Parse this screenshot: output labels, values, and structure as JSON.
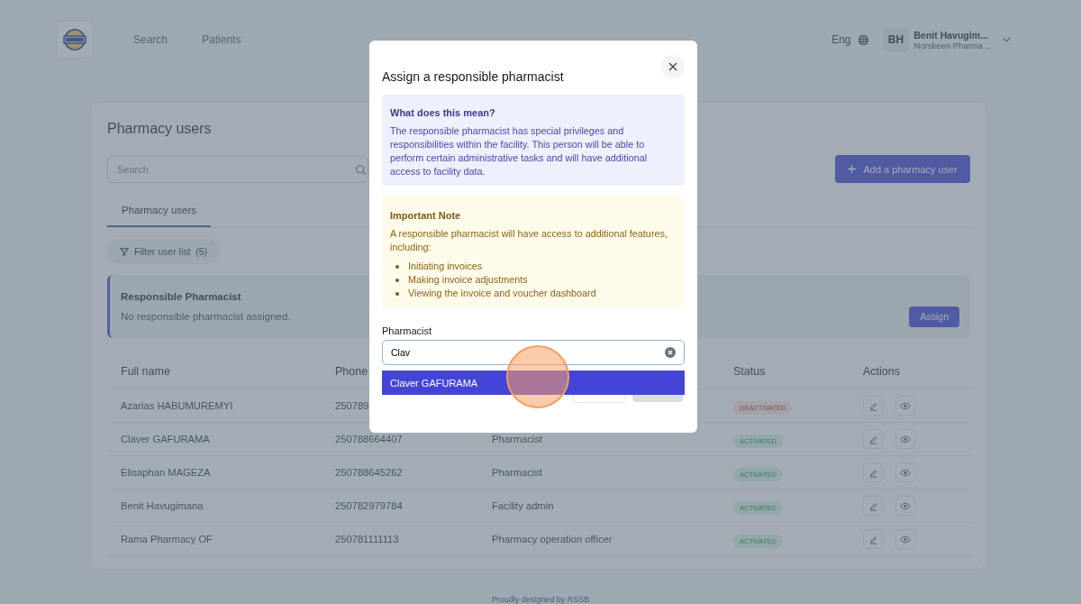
{
  "header": {
    "nav": [
      {
        "label": "Search",
        "selected": false
      },
      {
        "label": "Patients",
        "selected": false
      }
    ],
    "language": "Eng",
    "user": {
      "initials": "BH",
      "name": "Benit Havugim...",
      "organization": "Norskeen Pharma..."
    }
  },
  "page": {
    "title": "Pharmacy users",
    "search": {
      "placeholder": "Search"
    },
    "add_button": "Add a pharmacy user",
    "tabs": [
      {
        "label": "Pharmacy users",
        "selected": true
      }
    ],
    "filter_button": {
      "label": "Filter user list",
      "count": "(5)"
    },
    "responsible": {
      "title": "Responsible Pharmacist",
      "message": "No responsible pharmacist assigned.",
      "assign_button": "Assign"
    }
  },
  "table": {
    "headings": {
      "full_name": "Full name",
      "phone": "Phone",
      "status": "Status",
      "actions": "Actions"
    },
    "rows": [
      {
        "full_name": "Azarias HABUMUREMYI",
        "phone": "250789",
        "status": "DEACTIVATED",
        "active": false
      },
      {
        "full_name": "Claver GAFURAMA",
        "phone": "250788664407",
        "role": "Pharmacist",
        "status": "ACTIVATED",
        "active": true
      },
      {
        "full_name": "Elisaphan MAGEZA",
        "phone": "250788645262",
        "role": "Pharmacist",
        "status": "ACTIVATED",
        "active": true
      },
      {
        "full_name": "Benit Havugimana",
        "phone": "250782979784",
        "role": "Facility admin",
        "status": "ACTIVATED",
        "active": true
      },
      {
        "full_name": "Rama Pharmacy OF",
        "phone": "250781111113",
        "role": "Pharmacy operation officer",
        "status": "ACTIVATED",
        "active": true
      }
    ]
  },
  "footer": "Proudly designed by RSSB",
  "modal": {
    "title": "Assign a responsible pharmacist",
    "info": {
      "title": "What does this mean?",
      "text": "The responsible pharmacist has special privileges and responsibilities within the facility. This person will be able to perform certain administrative tasks and will have additional access to facility data."
    },
    "note": {
      "title": "Important Note",
      "text": "A responsible pharmacist will have access to additional features, including:",
      "items": [
        "Initiating invoices",
        "Making invoice adjustments",
        "Viewing the invoice and voucher dashboard"
      ]
    },
    "field": {
      "label": "Pharmacist",
      "value": "Clav"
    },
    "options": [
      {
        "label": "Claver GAFURAMA",
        "selected": true
      }
    ]
  }
}
